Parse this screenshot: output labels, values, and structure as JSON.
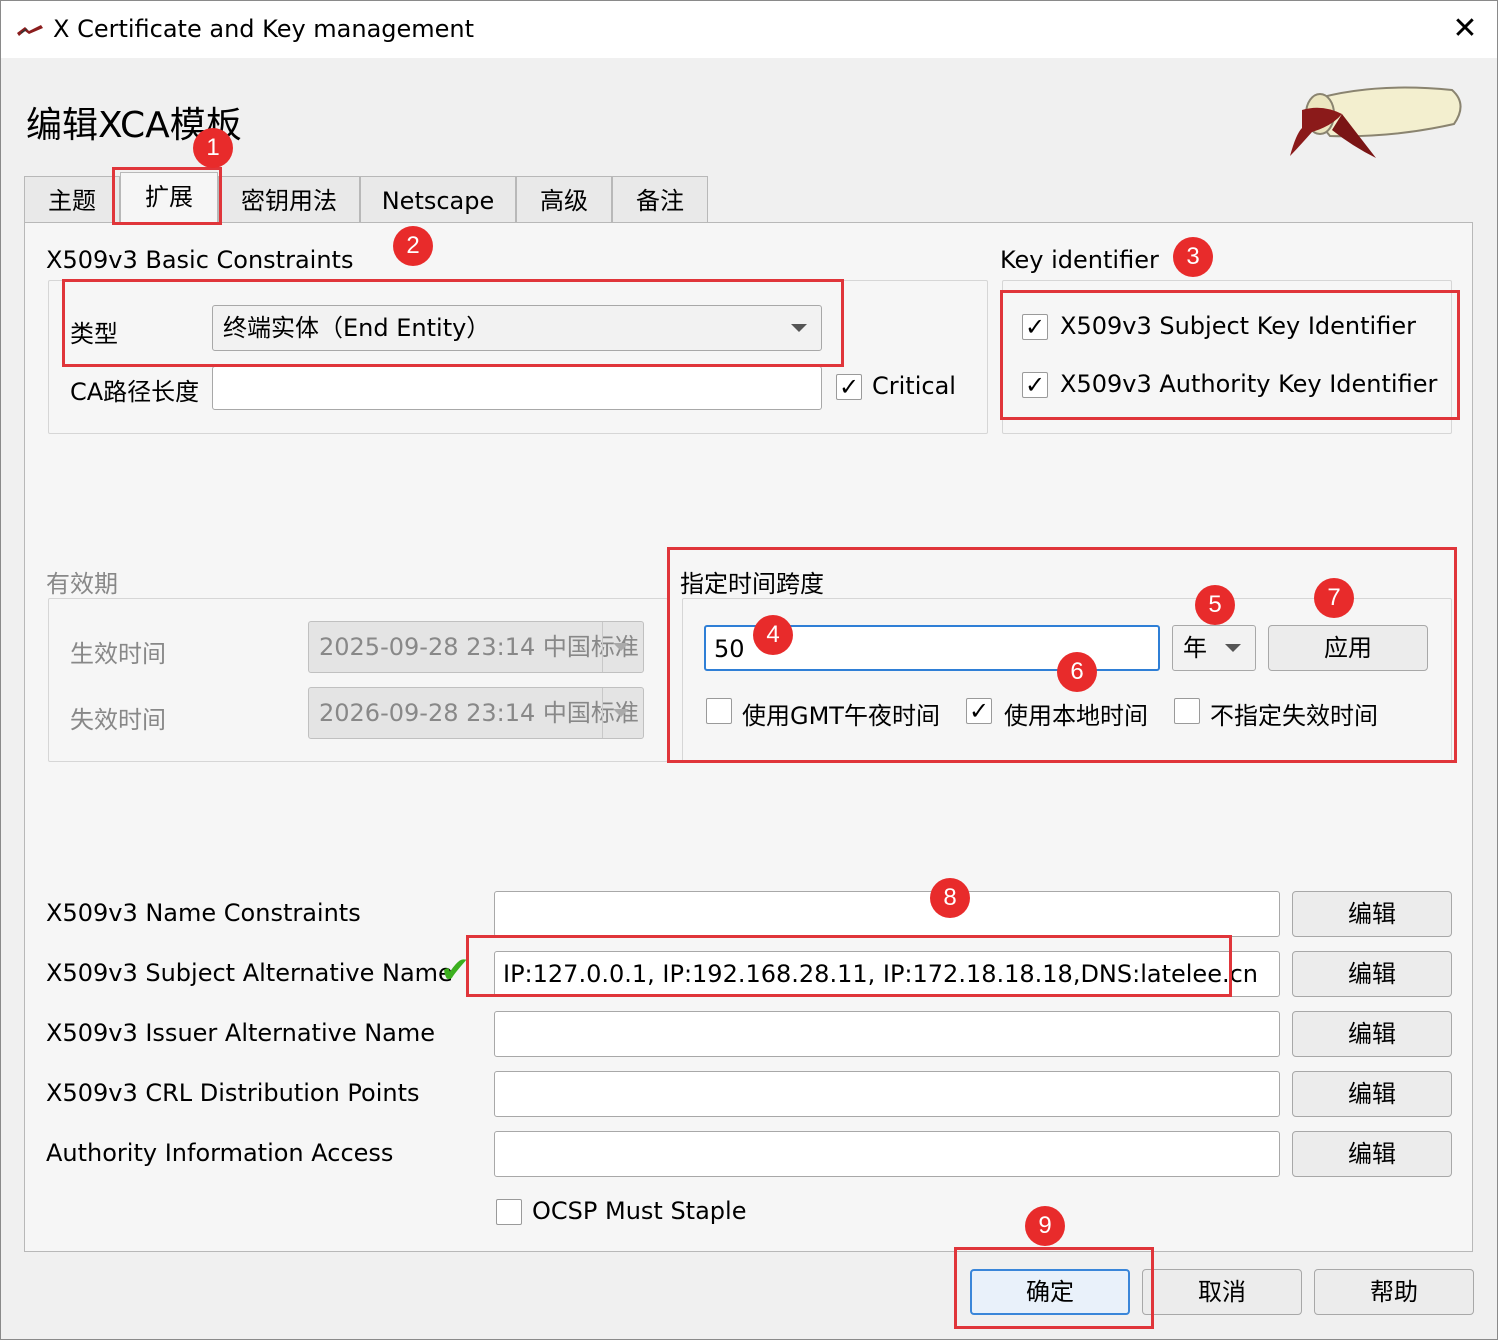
{
  "window": {
    "title": "X Certificate and Key management",
    "close_glyph": "✕"
  },
  "dialog": {
    "title": "编辑XCA模板"
  },
  "tabs": [
    "主题",
    "扩展",
    "密钥用法",
    "Netscape",
    "高级",
    "备注"
  ],
  "basic_constraints": {
    "title": "X509v3 Basic Constraints",
    "type_label": "类型",
    "type_value": "终端实体（End Entity）",
    "path_len_label": "CA路径长度",
    "path_len_value": "",
    "critical_label": "Critical",
    "critical_checked": "✓"
  },
  "key_identifier": {
    "title": "Key identifier",
    "subject_label": "X509v3 Subject Key Identifier",
    "subject_checked": "✓",
    "authority_label": "X509v3 Authority Key Identifier",
    "authority_checked": "✓"
  },
  "validity": {
    "title": "有效期",
    "not_before_label": "生效时间",
    "not_before_value": "2025-09-28 23:14 中国标准",
    "not_after_label": "失效时间",
    "not_after_value": "2026-09-28 23:14 中国标准"
  },
  "time_range": {
    "title": "指定时间跨度",
    "amount": "50",
    "unit": "年",
    "apply_label": "应用",
    "gmt_midnight_label": "使用GMT午夜时间",
    "gmt_midnight_checked": "",
    "local_time_label": "使用本地时间",
    "local_time_checked": "✓",
    "no_expiry_label": "不指定失效时间",
    "no_expiry_checked": ""
  },
  "extensions": [
    {
      "label": "X509v3 Name Constraints",
      "value": "",
      "button": "编辑"
    },
    {
      "label": "X509v3 Subject Alternative Name",
      "value": "IP:127.0.0.1, IP:192.168.28.11, IP:172.18.18.18,DNS:latelee.cn",
      "button": "编辑"
    },
    {
      "label": "X509v3 Issuer Alternative Name",
      "value": "",
      "button": "编辑"
    },
    {
      "label": "X509v3 CRL Distribution Points",
      "value": "",
      "button": "编辑"
    },
    {
      "label": "Authority Information Access",
      "value": "",
      "button": "编辑"
    }
  ],
  "valid_mark": "✔",
  "ocsp": {
    "label": "OCSP Must Staple",
    "checked": ""
  },
  "buttons": {
    "ok": "确定",
    "cancel": "取消",
    "help": "帮助"
  },
  "annotations": [
    "1",
    "2",
    "3",
    "4",
    "5",
    "6",
    "7",
    "8",
    "9"
  ],
  "colors": {
    "annotation": "#e0353a",
    "badge": "#e82b2b",
    "focus": "#2f7fd6",
    "valid_mark": "#3cb01f"
  }
}
